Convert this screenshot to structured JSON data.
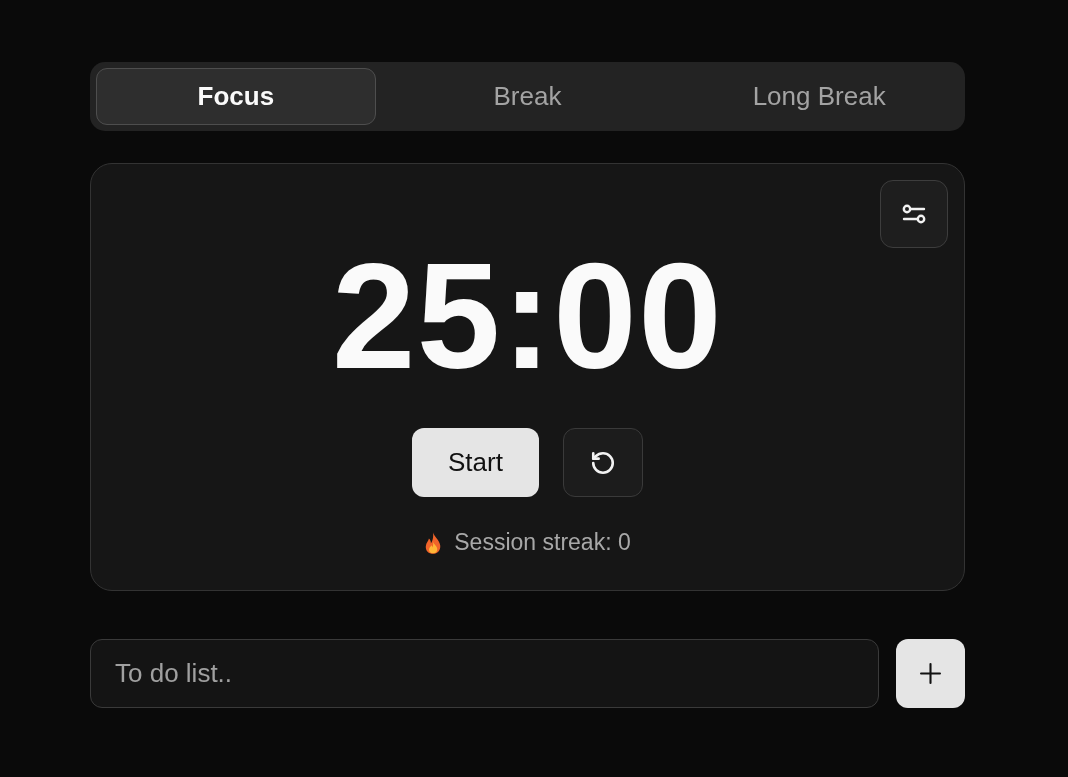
{
  "tabs": [
    {
      "label": "Focus",
      "selected": true
    },
    {
      "label": "Break",
      "selected": false
    },
    {
      "label": "Long Break",
      "selected": false
    }
  ],
  "timer": {
    "time": "25:00",
    "start_label": "Start",
    "streak": "Session streak: 0"
  },
  "todo": {
    "placeholder": "To do list.."
  }
}
